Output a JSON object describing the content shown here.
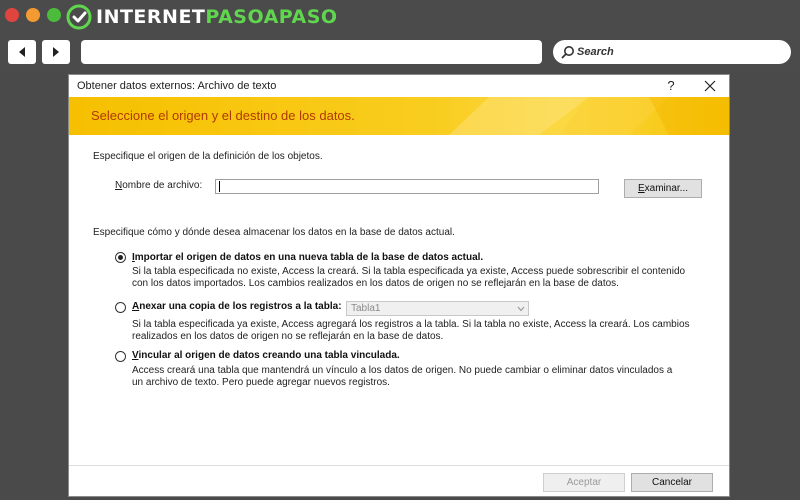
{
  "browser": {
    "logo": "INTERNETPASOAPASO",
    "search_placeholder": "Search",
    "colors": {
      "chrome": "#4b4b4b",
      "logo_accent": "#5fd64e"
    }
  },
  "dialog": {
    "title": "Obtener datos externos: Archivo de texto",
    "help_label": "?",
    "banner": "Seleccione el origen y el destino de los datos.",
    "source_heading": "Especifique el origen de la definición de los objetos.",
    "filename_label_key": "N",
    "filename_label_rest": "ombre de archivo:",
    "filename_value": "",
    "browse_key": "E",
    "browse_rest": "xaminar...",
    "storage_heading": "Especifique cómo y dónde desea almacenar los datos en la base de datos actual.",
    "options": [
      {
        "key": "I",
        "label_rest": "mportar el origen de datos en una nueva tabla de la base de datos actual.",
        "desc1": "Si la tabla especificada no existe, Access la creará. Si la tabla especificada ya existe, Access puede sobrescribir el contenido",
        "desc2": "con los datos importados. Los cambios realizados en los datos de origen no se reflejarán en la base de datos."
      },
      {
        "key": "A",
        "label_rest": "nexar una copia de los registros a la tabla:",
        "combo_value": "Tabla1",
        "desc1": "Si la tabla especificada ya existe, Access agregará los registros a la tabla. Si la tabla no existe, Access la creará. Los cambios",
        "desc2": "realizados en los datos de origen no se reflejarán en la base de datos."
      },
      {
        "key": "V",
        "label_rest": "incular al origen de datos creando una tabla vinculada.",
        "desc1": "Access creará una tabla que mantendrá un vínculo a los datos de origen. No puede cambiar o eliminar datos vinculados a",
        "desc2": "un archivo de texto. Pero puede agregar nuevos registros."
      }
    ],
    "selected_option": 0,
    "accept_label": "Aceptar",
    "cancel_label": "Cancelar",
    "colors": {
      "banner": "#f6c000",
      "banner_text": "#b03a00"
    }
  }
}
